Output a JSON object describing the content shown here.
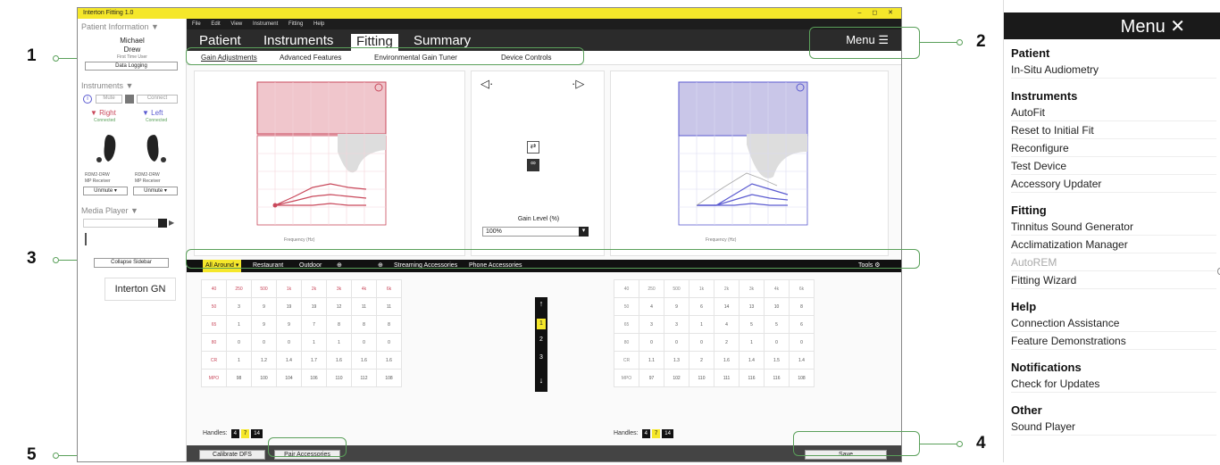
{
  "window": {
    "title": "Interton Fitting 1.0",
    "controls": "– ◻ ✕"
  },
  "menubar": [
    "File",
    "Edit",
    "View",
    "Instrument",
    "Fitting",
    "Help"
  ],
  "tabs": [
    "Patient",
    "Instruments",
    "Fitting",
    "Summary"
  ],
  "active_tab": "Fitting",
  "menu_button": "Menu ☰",
  "subtabs": [
    "Gain Adjustments",
    "Advanced Features",
    "Environmental Gain Tuner",
    "Device Controls"
  ],
  "sidebar": {
    "patient_header": "Patient Information ▼",
    "patient_first": "Michael",
    "patient_last": "Drew",
    "patient_sub": "First Time User",
    "data_logging": "Data Logging",
    "instruments_header": "Instruments ▼",
    "mute_btn": "Mute",
    "connect_btn": "Connect",
    "right_label": "▼ Right",
    "left_label": "▼ Left",
    "right_status": "Connected",
    "left_status": "Connected",
    "right_model": "RDM2-DRW",
    "left_model": "RDM2-DRW",
    "right_receiver": "MP Receiver",
    "left_receiver": "MP Receiver",
    "unmute_r": "Unmute ▾",
    "unmute_l": "Unmute ▾",
    "media_header": "Media Player ▼",
    "collapse": "Collapse Sidebar",
    "logo": "Interton GN"
  },
  "center": {
    "gain_level_label": "Gain Level (%)",
    "gain_level_value": "100%"
  },
  "programs": [
    "All Around ▾",
    "Restaurant",
    "Outdoor",
    "⊕",
    "⊕",
    "Streaming Accessories",
    "Phone Accessories"
  ],
  "tools": "Tools ⚙",
  "steps": [
    "1",
    "2",
    "3"
  ],
  "left_table": [
    [
      "40",
      "250",
      "500",
      "1k",
      "2k",
      "3k",
      "4k",
      "6k"
    ],
    [
      "50",
      "3",
      "9",
      "19",
      "19",
      "12",
      "11",
      "11"
    ],
    [
      "65",
      "1",
      "9",
      "9",
      "7",
      "8",
      "8",
      "8"
    ],
    [
      "80",
      "0",
      "0",
      "0",
      "1",
      "1",
      "0",
      "0"
    ],
    [
      "CR",
      "1",
      "1.2",
      "1.4",
      "1.7",
      "1.6",
      "1.6",
      "1.6"
    ],
    [
      "MPO",
      "98",
      "100",
      "104",
      "106",
      "110",
      "112",
      "108"
    ]
  ],
  "right_table": [
    [
      "40",
      "250",
      "500",
      "1k",
      "2k",
      "3k",
      "4k",
      "6k"
    ],
    [
      "50",
      "4",
      "9",
      "6",
      "14",
      "13",
      "10",
      "8"
    ],
    [
      "65",
      "3",
      "3",
      "1",
      "4",
      "5",
      "5",
      "6"
    ],
    [
      "80",
      "0",
      "0",
      "0",
      "2",
      "1",
      "0",
      "0"
    ],
    [
      "CR",
      "1.1",
      "1.3",
      "2",
      "1.6",
      "1.4",
      "1.5",
      "1.4"
    ],
    [
      "MPO",
      "97",
      "102",
      "110",
      "111",
      "116",
      "116",
      "108"
    ]
  ],
  "handles": {
    "label": "Handles:",
    "values": [
      "4",
      "7",
      "14"
    ]
  },
  "buttons": {
    "calibrate": "Calibrate DFS",
    "pair": "Pair Accessories",
    "save": "Save"
  },
  "callouts": [
    "1",
    "2",
    "3",
    "4",
    "5"
  ],
  "right_menu": {
    "title": "Menu ✕",
    "sections": [
      {
        "header": "Patient",
        "items": [
          "In-Situ Audiometry"
        ]
      },
      {
        "header": "Instruments",
        "items": [
          "AutoFit",
          "Reset to Initial Fit",
          "Reconfigure",
          "Test Device",
          "Accessory Updater"
        ]
      },
      {
        "header": "Fitting",
        "items": [
          "Tinnitus Sound Generator",
          "Acclimatization Manager",
          "AutoREM",
          "Fitting Wizard"
        ]
      },
      {
        "header": "Help",
        "items": [
          "Connection Assistance",
          "Feature Demonstrations"
        ]
      },
      {
        "header": "Notifications",
        "items": [
          "Check for Updates"
        ]
      },
      {
        "header": "Other",
        "items": [
          "Sound Player"
        ]
      }
    ]
  },
  "colors": {
    "accent": "#f5e72a",
    "right_ear": "#c9485b",
    "left_ear": "#5a5ad0",
    "callout": "#5aa05a"
  }
}
